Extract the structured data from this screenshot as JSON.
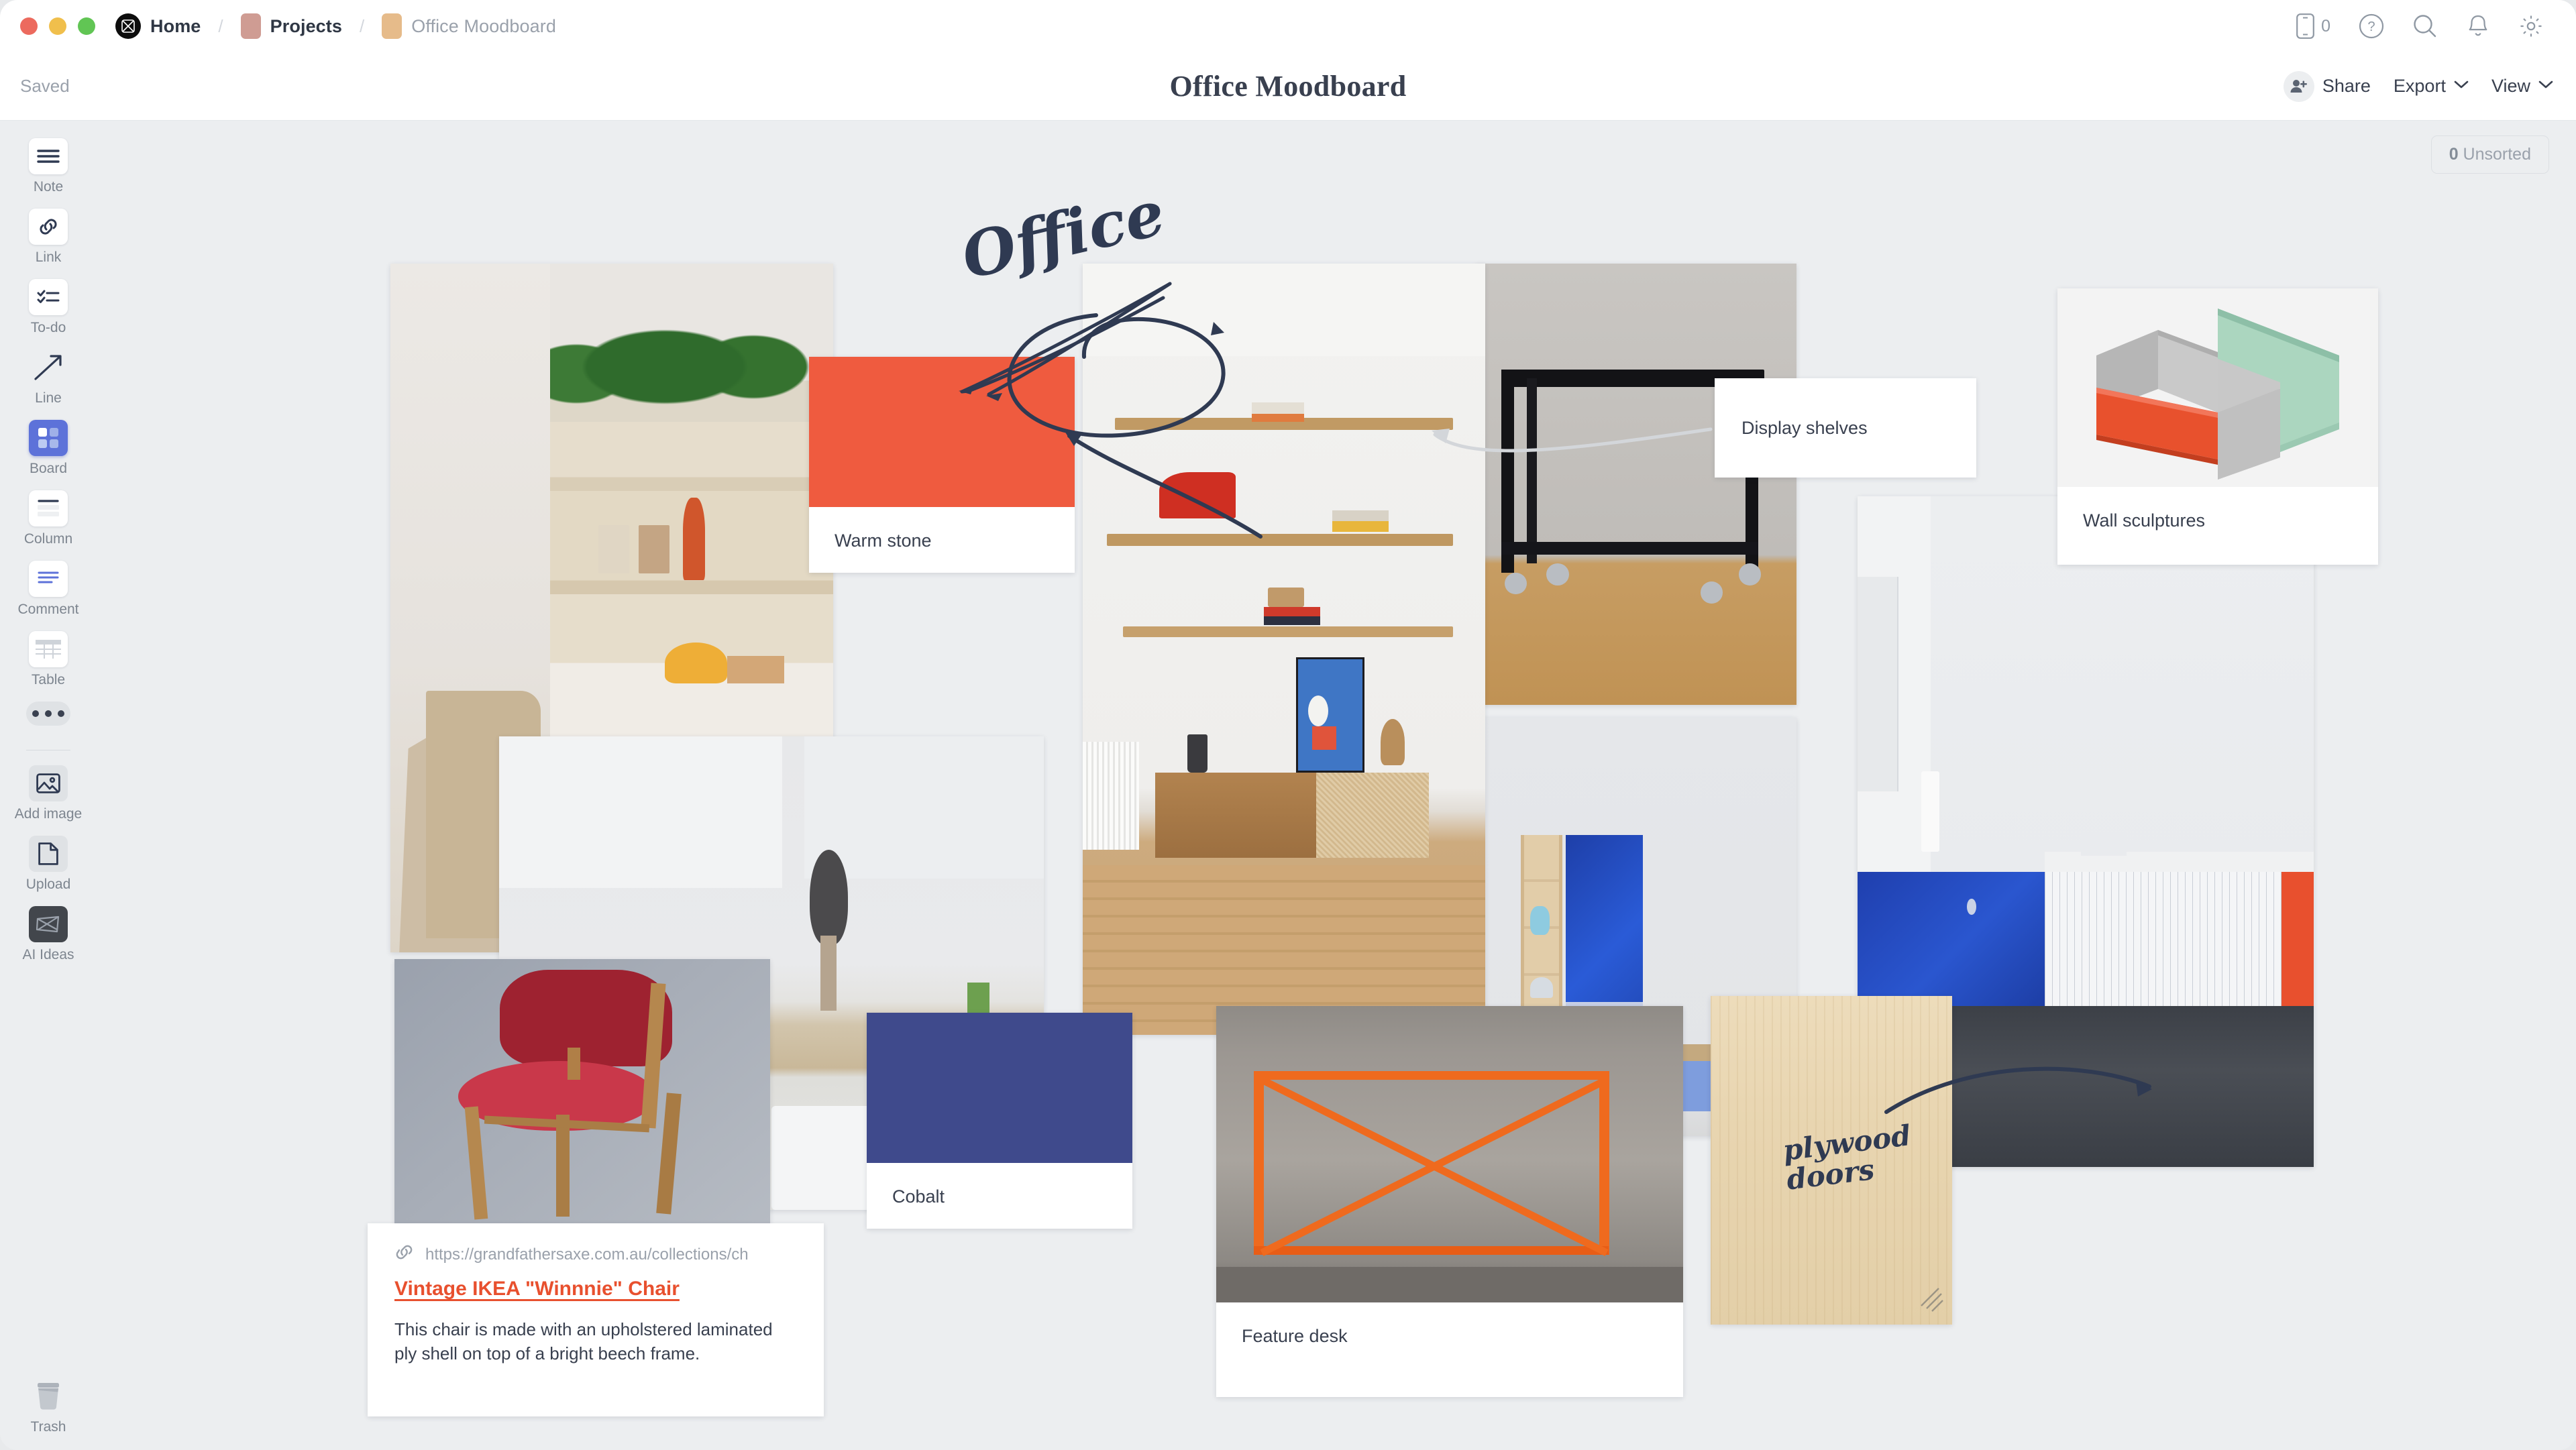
{
  "window": {
    "traffic_lights": [
      "close",
      "minimize",
      "maximize"
    ],
    "breadcrumb": [
      {
        "label": "Home",
        "icon": "milanote-logo-icon",
        "muted": false
      },
      {
        "label": "Projects",
        "icon": "folder-chip-icon",
        "chip_color": "#cf9c93",
        "muted": false
      },
      {
        "label": "Office Moodboard",
        "icon": "folder-chip-icon",
        "chip_color": "#e6bb8a",
        "muted": true
      }
    ],
    "right_icons": [
      {
        "name": "mobile-icon",
        "count": "0"
      },
      {
        "name": "help-icon"
      },
      {
        "name": "search-icon"
      },
      {
        "name": "notifications-bell-icon"
      },
      {
        "name": "settings-gear-icon"
      }
    ]
  },
  "header": {
    "save_status": "Saved",
    "title": "Office Moodboard",
    "share_label": "Share",
    "export_label": "Export",
    "view_label": "View"
  },
  "sidebar": {
    "tools": [
      {
        "label": "Note",
        "icon": "note-icon",
        "style": "white"
      },
      {
        "label": "Link",
        "icon": "link-icon",
        "style": "white"
      },
      {
        "label": "To-do",
        "icon": "todo-icon",
        "style": "white"
      },
      {
        "label": "Line",
        "icon": "line-arrow-icon",
        "style": "plain"
      },
      {
        "label": "Board",
        "icon": "board-icon",
        "style": "active"
      },
      {
        "label": "Column",
        "icon": "column-icon",
        "style": "white"
      },
      {
        "label": "Comment",
        "icon": "comment-icon",
        "style": "white"
      },
      {
        "label": "Table",
        "icon": "table-icon",
        "style": "white"
      },
      {
        "label": "",
        "icon": "more-dots-icon",
        "style": "dots"
      },
      {
        "label": "Add image",
        "icon": "add-image-icon",
        "style": "grey"
      },
      {
        "label": "Upload",
        "icon": "upload-icon",
        "style": "grey"
      },
      {
        "label": "AI Ideas",
        "icon": "ai-ideas-icon",
        "style": "dark"
      }
    ],
    "trash": {
      "label": "Trash",
      "icon": "trash-icon"
    }
  },
  "canvas": {
    "unsorted_count": "0",
    "unsorted_label": "Unsorted",
    "annotations": [
      {
        "name": "office-handwriting",
        "text": "Office"
      },
      {
        "name": "plywood-doors-handwriting",
        "text": "plywood doors"
      }
    ],
    "cards": [
      {
        "name": "card-shelf-plants",
        "type": "image",
        "alt": "timber shelving unit with plants"
      },
      {
        "name": "card-warm-stone",
        "type": "swatch",
        "caption": "Warm stone",
        "color": "#ef5b3f"
      },
      {
        "name": "card-kitchen-bench",
        "type": "image",
        "alt": "pale timber bench with flowers"
      },
      {
        "name": "card-shelves-room",
        "type": "image",
        "alt": "oak wall shelves with red elephant and bauhaus print"
      },
      {
        "name": "card-black-trolley",
        "type": "image",
        "alt": "black steel trolley table on castors"
      },
      {
        "name": "card-display-shelves",
        "type": "label",
        "caption": "Display shelves"
      },
      {
        "name": "card-wall-sculptures",
        "type": "image-caption",
        "caption": "Wall sculptures",
        "alt": "hexagonal geometric wall sculpture"
      },
      {
        "name": "card-blue-cabinet",
        "type": "image",
        "alt": "blue gloss cabinetry with timber shelf"
      },
      {
        "name": "card-blue-kitchen",
        "type": "image",
        "alt": "cobalt blue kitchen with tiled island"
      },
      {
        "name": "card-red-chair",
        "type": "image",
        "alt": "red upholstered mid-century chair"
      },
      {
        "name": "card-vintage-chair-link",
        "type": "link",
        "url": "https://grandfathersaxe.com.au/collections/ch",
        "title": "Vintage IKEA \"Winnnie\" Chair",
        "description": "This chair is made with an upholstered laminated ply shell on top of a bright beech frame."
      },
      {
        "name": "card-cobalt",
        "type": "swatch",
        "caption": "Cobalt",
        "color": "#3f4a8c"
      },
      {
        "name": "card-feature-desk",
        "type": "image-caption",
        "caption": "Feature desk",
        "alt": "orange steel desk frame against concrete"
      },
      {
        "name": "card-plywood",
        "type": "image",
        "alt": "plywood door panel"
      }
    ]
  },
  "colors": {
    "accent_orange": "#ef5b3f",
    "accent_cobalt": "#3f4a8c",
    "board_active": "#5d72d9",
    "link_orange": "#e8502e",
    "text_dark": "#39404f",
    "text_muted": "#9aa1ab",
    "canvas_bg": "#eceef0"
  }
}
